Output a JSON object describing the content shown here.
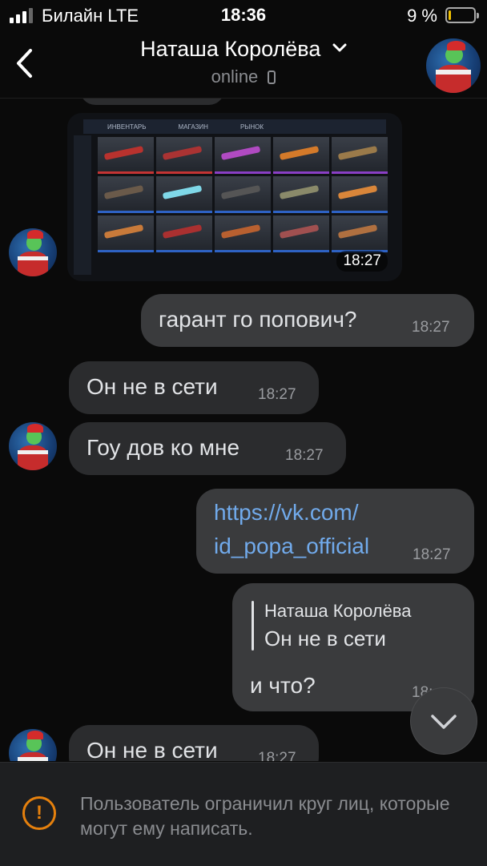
{
  "status_bar": {
    "carrier": "Билайн  LTE",
    "time": "18:36",
    "battery": "9 %",
    "battery_level": 0.09
  },
  "header": {
    "title": "Наташа Королёва",
    "subtitle": "online"
  },
  "image_message": {
    "time": "18:27",
    "tabs": [
      "ИНВЕНТАРЬ",
      "МАГАЗИН",
      "РЫНОК"
    ]
  },
  "messages": [
    {
      "text": "гарант го попович?",
      "time": "18:27",
      "direction": "out"
    },
    {
      "text": "Он не в сети",
      "time": "18:27",
      "direction": "in"
    },
    {
      "text": "Гоу дов ко мне",
      "time": "18:27",
      "direction": "in"
    },
    {
      "text_line1": "https://vk.com/",
      "text_line2": "id_popa_official",
      "time": "18:27",
      "direction": "out"
    },
    {
      "reply_author": "Наташа Королёва",
      "reply_text": "Он не в сети",
      "text": "и что?",
      "time": "18:",
      "direction": "out"
    },
    {
      "text": "Он не в сети",
      "time": "18:27",
      "direction": "in"
    }
  ],
  "footer": {
    "notice": "Пользователь ограничил круг лиц, которые могут ему написать."
  },
  "colors": {
    "accent_link": "#71aaeb",
    "warning": "#e5800d",
    "battery": "#f2c200"
  }
}
